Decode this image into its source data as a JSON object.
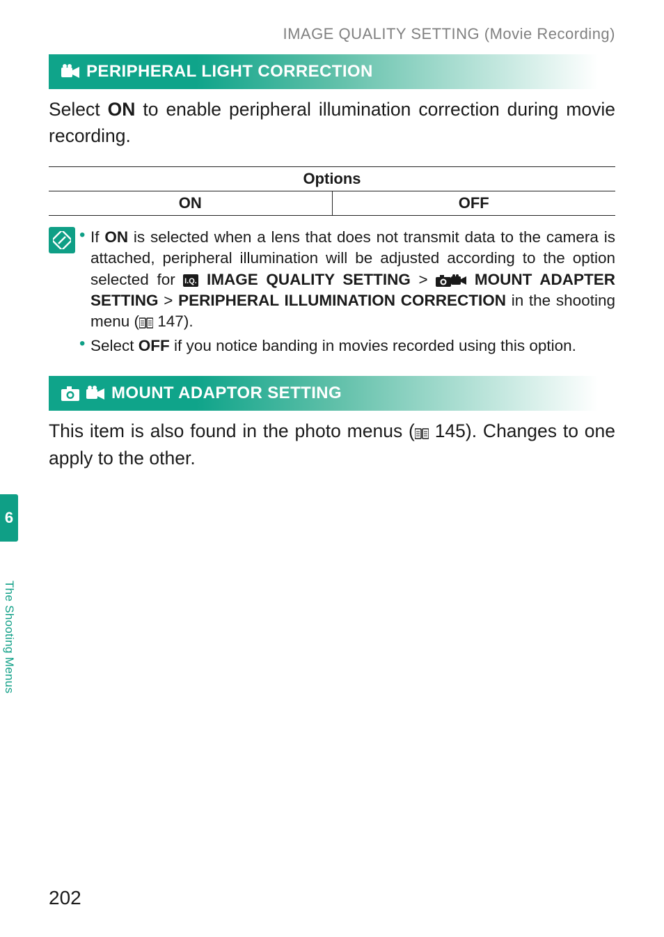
{
  "header": {
    "running": "IMAGE QUALITY SETTING (Movie Recording)"
  },
  "sections": [
    {
      "icon": "movie-icon",
      "title": "PERIPHERAL LIGHT CORRECTION",
      "intro_html": "Select <b>ON</b> to enable peripheral illumination correction during movie recording.",
      "table": {
        "header": "Options",
        "cells": [
          "ON",
          "OFF"
        ]
      },
      "notes": [
        "If <b>ON</b> is selected when a lens that does not transmit data to the camera is attached, peripheral illumination will be adjusted according to the option selected for <span class=\"inline-icon\" data-name=\"iq-badge-icon\" data-interactable=\"false\"><svg width=\"22\" height=\"18\" viewBox=\"0 0 22 18\"><rect x=\"0\" y=\"0\" width=\"22\" height=\"18\" rx=\"2\" fill=\"#1a1a1a\"/><text x=\"11\" y=\"13\" text-anchor=\"middle\" font-size=\"11\" font-weight=\"700\" fill=\"#fff\" font-family=\"Arial\">I.Q.</text></svg></span> <b>IMAGE QUALITY SETTING</b> &gt; <span class=\"inline-icon\" data-name=\"camera-icon\" data-interactable=\"false\"><svg width=\"22\" height=\"18\" viewBox=\"0 0 22 18\"><rect x=\"0\" y=\"4\" width=\"22\" height=\"14\" rx=\"2\" fill=\"#1a1a1a\"/><rect x=\"6\" y=\"1\" width=\"6\" height=\"4\" fill=\"#1a1a1a\"/><circle cx=\"11\" cy=\"11\" r=\"4.5\" fill=\"#fff\"/><circle cx=\"11\" cy=\"11\" r=\"2.4\" fill=\"#1a1a1a\"/></svg></span><span class=\"inline-icon\" data-name=\"movie-icon\" data-interactable=\"false\"><svg width=\"22\" height=\"18\" viewBox=\"0 0 22 18\"><rect x=\"0\" y=\"3\" width=\"14\" height=\"12\" rx=\"2\" fill=\"#1a1a1a\"/><polygon points=\"14,7 22,3 22,15 14,11\" fill=\"#1a1a1a\"/><circle cx=\"4\" cy=\"2\" r=\"2\" fill=\"#1a1a1a\"/><circle cx=\"9\" cy=\"2\" r=\"2\" fill=\"#1a1a1a\"/></svg></span> <b>MOUNT ADAPTER SETTING</b> &gt; <b>PERIPHERAL ILLUMINATION CORRECTION</b> in the shooting menu (<span class=\"inline-icon\" data-name=\"page-ref-icon\" data-interactable=\"false\"><svg width=\"20\" height=\"16\" viewBox=\"0 0 20 16\"><rect x=\"0\" y=\"1\" width=\"9\" height=\"14\" rx=\"1\" fill=\"none\" stroke=\"#1a1a1a\" stroke-width=\"1.5\"/><rect x=\"11\" y=\"1\" width=\"9\" height=\"14\" rx=\"1\" fill=\"none\" stroke=\"#1a1a1a\" stroke-width=\"1.5\"/><line x1=\"2\" y1=\"5\" x2=\"7\" y2=\"5\" stroke=\"#1a1a1a\"/><line x1=\"2\" y1=\"8\" x2=\"7\" y2=\"8\" stroke=\"#1a1a1a\"/><line x1=\"2\" y1=\"11\" x2=\"7\" y2=\"11\" stroke=\"#1a1a1a\"/><line x1=\"13\" y1=\"5\" x2=\"18\" y2=\"5\" stroke=\"#1a1a1a\"/><line x1=\"13\" y1=\"8\" x2=\"18\" y2=\"8\" stroke=\"#1a1a1a\"/><line x1=\"13\" y1=\"11\" x2=\"18\" y2=\"11\" stroke=\"#1a1a1a\"/></svg></span> 147).",
        "Select <b>OFF</b> if you notice banding in movies recorded using this option."
      ]
    },
    {
      "icons": [
        "camera-icon",
        "movie-icon"
      ],
      "title": "MOUNT ADAPTOR SETTING",
      "intro_html": "This item is also found in the photo menus (<span class=\"inline-icon\" data-name=\"page-ref-icon\" data-interactable=\"false\"><svg width=\"20\" height=\"16\" viewBox=\"0 0 20 16\"><rect x=\"0\" y=\"1\" width=\"9\" height=\"14\" rx=\"1\" fill=\"none\" stroke=\"#1a1a1a\" stroke-width=\"1.5\"/><rect x=\"11\" y=\"1\" width=\"9\" height=\"14\" rx=\"1\" fill=\"none\" stroke=\"#1a1a1a\" stroke-width=\"1.5\"/><line x1=\"2\" y1=\"5\" x2=\"7\" y2=\"5\" stroke=\"#1a1a1a\"/><line x1=\"2\" y1=\"8\" x2=\"7\" y2=\"8\" stroke=\"#1a1a1a\"/><line x1=\"2\" y1=\"11\" x2=\"7\" y2=\"11\" stroke=\"#1a1a1a\"/><line x1=\"13\" y1=\"5\" x2=\"18\" y2=\"5\" stroke=\"#1a1a1a\"/><line x1=\"13\" y1=\"8\" x2=\"18\" y2=\"8\" stroke=\"#1a1a1a\"/><line x1=\"13\" y1=\"11\" x2=\"18\" y2=\"11\" stroke=\"#1a1a1a\"/></svg></span> 145). Changes to one apply to the other."
    }
  ],
  "side": {
    "chapter": "6",
    "label": "The Shooting Menus"
  },
  "page_number": "202"
}
